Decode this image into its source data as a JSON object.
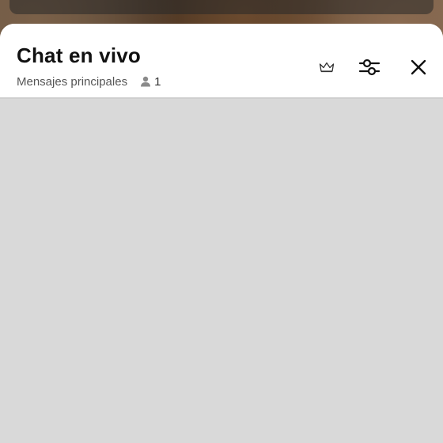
{
  "video": {
    "overlay_text": "",
    "accent": "#5b3f26"
  },
  "chat_panel": {
    "title": "Chat en vivo",
    "mode_label": "Mensajes principales",
    "viewer_count": "1",
    "icons": {
      "crown": "crown-icon",
      "filter": "sliders-icon",
      "close": "close-icon",
      "viewers": "person-icon"
    }
  },
  "colors": {
    "sheet_bg": "#ffffff",
    "chat_bg": "#d9d9d9",
    "title_text": "#111111",
    "subtitle_text": "#555555"
  }
}
